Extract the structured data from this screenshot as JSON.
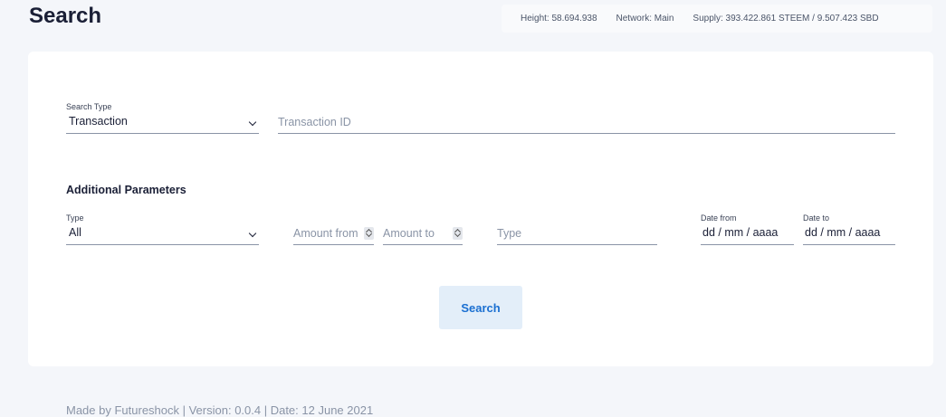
{
  "page": {
    "title": "Search"
  },
  "chain_info": {
    "height": "Height: 58.694.938",
    "network": "Network: Main",
    "supply": "Supply: 393.422.861 STEEM / 9.507.423 SBD"
  },
  "search": {
    "type_label": "Search Type",
    "type_value": "Transaction",
    "id_placeholder": "Transaction ID"
  },
  "additional": {
    "title": "Additional Parameters",
    "type_label": "Type",
    "type_value": "All",
    "amount_from_placeholder": "Amount from",
    "amount_to_placeholder": "Amount to",
    "op_type_placeholder": "Type",
    "date_from_label": "Date from",
    "date_from_value": "dd / mm / aaaa",
    "date_to_label": "Date to",
    "date_to_value": "dd / mm / aaaa"
  },
  "actions": {
    "search_label": "Search"
  },
  "footer": {
    "text": "Made by Futureshock | Version: 0.0.4 | Date: 12 June 2021"
  }
}
